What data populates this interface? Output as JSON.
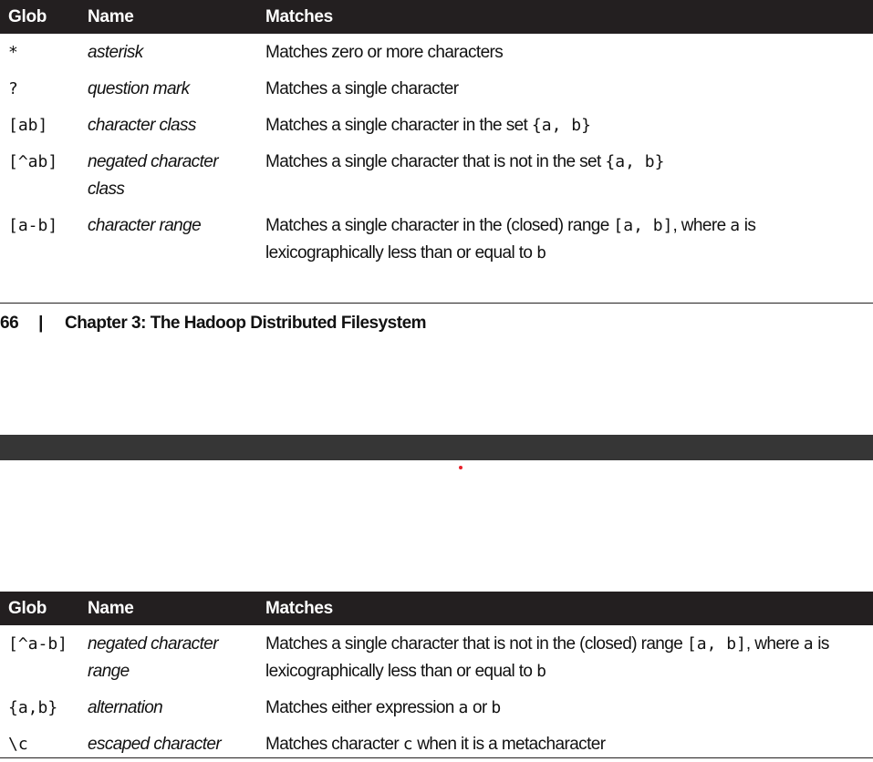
{
  "table_top": {
    "headers": {
      "glob": "Glob",
      "name": "Name",
      "matches": "Matches"
    },
    "rows": [
      {
        "glob": "*",
        "name": "asterisk",
        "desc": [
          "Matches zero or more characters"
        ]
      },
      {
        "glob": "?",
        "name": "question mark",
        "desc": [
          "Matches a single character"
        ]
      },
      {
        "glob": "[ab]",
        "name": "character class",
        "desc": [
          "Matches a single character in the set ",
          "{a, b}",
          ""
        ]
      },
      {
        "glob": "[^ab]",
        "name": "negated character class",
        "desc": [
          "Matches a single character that is not in the set ",
          "{a, b}",
          ""
        ]
      },
      {
        "glob": "[a-b]",
        "name": "character range",
        "desc": [
          "Matches a single character in the (closed) range ",
          "[a, b]",
          ", where ",
          "a",
          " is lexicographically less than or equal to ",
          "b",
          ""
        ]
      }
    ]
  },
  "footer": {
    "page_number": "66",
    "separator": "|",
    "chapter": "Chapter 3: The Hadoop Distributed Filesystem"
  },
  "table_bottom": {
    "headers": {
      "glob": "Glob",
      "name": "Name",
      "matches": "Matches"
    },
    "rows": [
      {
        "glob": "[^a-b]",
        "name": "negated character range",
        "desc": [
          "Matches a single character that is not in the (closed) range ",
          "[a, b]",
          ", where ",
          "a",
          " is lexicographically less than or equal to ",
          "b",
          ""
        ]
      },
      {
        "glob": "{a,b}",
        "name": "alternation",
        "desc": [
          "Matches either expression ",
          "a",
          " or ",
          "b",
          ""
        ]
      },
      {
        "glob": "\\c",
        "name": "escaped character",
        "desc": [
          "Matches character ",
          "c",
          " when it is a metacharacter"
        ]
      }
    ]
  },
  "colors": {
    "header_bg": "#231f20",
    "header_text": "#ffffff",
    "separator_bar": "#363636",
    "dot": "#e8202a"
  }
}
